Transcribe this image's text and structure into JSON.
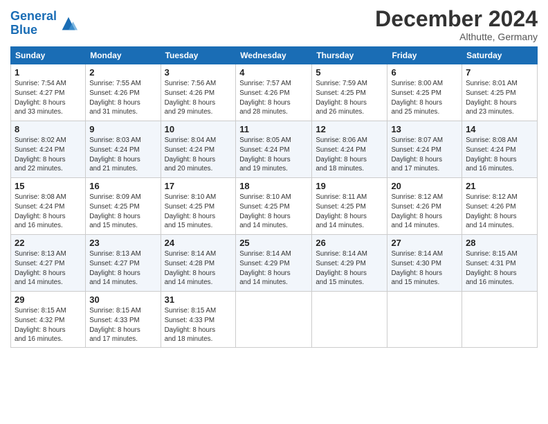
{
  "header": {
    "logo_line1": "General",
    "logo_line2": "Blue",
    "month": "December 2024",
    "location": "Althutte, Germany"
  },
  "weekdays": [
    "Sunday",
    "Monday",
    "Tuesday",
    "Wednesday",
    "Thursday",
    "Friday",
    "Saturday"
  ],
  "weeks": [
    [
      {
        "day": "1",
        "info": "Sunrise: 7:54 AM\nSunset: 4:27 PM\nDaylight: 8 hours\nand 33 minutes."
      },
      {
        "day": "2",
        "info": "Sunrise: 7:55 AM\nSunset: 4:26 PM\nDaylight: 8 hours\nand 31 minutes."
      },
      {
        "day": "3",
        "info": "Sunrise: 7:56 AM\nSunset: 4:26 PM\nDaylight: 8 hours\nand 29 minutes."
      },
      {
        "day": "4",
        "info": "Sunrise: 7:57 AM\nSunset: 4:26 PM\nDaylight: 8 hours\nand 28 minutes."
      },
      {
        "day": "5",
        "info": "Sunrise: 7:59 AM\nSunset: 4:25 PM\nDaylight: 8 hours\nand 26 minutes."
      },
      {
        "day": "6",
        "info": "Sunrise: 8:00 AM\nSunset: 4:25 PM\nDaylight: 8 hours\nand 25 minutes."
      },
      {
        "day": "7",
        "info": "Sunrise: 8:01 AM\nSunset: 4:25 PM\nDaylight: 8 hours\nand 23 minutes."
      }
    ],
    [
      {
        "day": "8",
        "info": "Sunrise: 8:02 AM\nSunset: 4:24 PM\nDaylight: 8 hours\nand 22 minutes."
      },
      {
        "day": "9",
        "info": "Sunrise: 8:03 AM\nSunset: 4:24 PM\nDaylight: 8 hours\nand 21 minutes."
      },
      {
        "day": "10",
        "info": "Sunrise: 8:04 AM\nSunset: 4:24 PM\nDaylight: 8 hours\nand 20 minutes."
      },
      {
        "day": "11",
        "info": "Sunrise: 8:05 AM\nSunset: 4:24 PM\nDaylight: 8 hours\nand 19 minutes."
      },
      {
        "day": "12",
        "info": "Sunrise: 8:06 AM\nSunset: 4:24 PM\nDaylight: 8 hours\nand 18 minutes."
      },
      {
        "day": "13",
        "info": "Sunrise: 8:07 AM\nSunset: 4:24 PM\nDaylight: 8 hours\nand 17 minutes."
      },
      {
        "day": "14",
        "info": "Sunrise: 8:08 AM\nSunset: 4:24 PM\nDaylight: 8 hours\nand 16 minutes."
      }
    ],
    [
      {
        "day": "15",
        "info": "Sunrise: 8:08 AM\nSunset: 4:24 PM\nDaylight: 8 hours\nand 16 minutes."
      },
      {
        "day": "16",
        "info": "Sunrise: 8:09 AM\nSunset: 4:25 PM\nDaylight: 8 hours\nand 15 minutes."
      },
      {
        "day": "17",
        "info": "Sunrise: 8:10 AM\nSunset: 4:25 PM\nDaylight: 8 hours\nand 15 minutes."
      },
      {
        "day": "18",
        "info": "Sunrise: 8:10 AM\nSunset: 4:25 PM\nDaylight: 8 hours\nand 14 minutes."
      },
      {
        "day": "19",
        "info": "Sunrise: 8:11 AM\nSunset: 4:25 PM\nDaylight: 8 hours\nand 14 minutes."
      },
      {
        "day": "20",
        "info": "Sunrise: 8:12 AM\nSunset: 4:26 PM\nDaylight: 8 hours\nand 14 minutes."
      },
      {
        "day": "21",
        "info": "Sunrise: 8:12 AM\nSunset: 4:26 PM\nDaylight: 8 hours\nand 14 minutes."
      }
    ],
    [
      {
        "day": "22",
        "info": "Sunrise: 8:13 AM\nSunset: 4:27 PM\nDaylight: 8 hours\nand 14 minutes."
      },
      {
        "day": "23",
        "info": "Sunrise: 8:13 AM\nSunset: 4:27 PM\nDaylight: 8 hours\nand 14 minutes."
      },
      {
        "day": "24",
        "info": "Sunrise: 8:14 AM\nSunset: 4:28 PM\nDaylight: 8 hours\nand 14 minutes."
      },
      {
        "day": "25",
        "info": "Sunrise: 8:14 AM\nSunset: 4:29 PM\nDaylight: 8 hours\nand 14 minutes."
      },
      {
        "day": "26",
        "info": "Sunrise: 8:14 AM\nSunset: 4:29 PM\nDaylight: 8 hours\nand 15 minutes."
      },
      {
        "day": "27",
        "info": "Sunrise: 8:14 AM\nSunset: 4:30 PM\nDaylight: 8 hours\nand 15 minutes."
      },
      {
        "day": "28",
        "info": "Sunrise: 8:15 AM\nSunset: 4:31 PM\nDaylight: 8 hours\nand 16 minutes."
      }
    ],
    [
      {
        "day": "29",
        "info": "Sunrise: 8:15 AM\nSunset: 4:32 PM\nDaylight: 8 hours\nand 16 minutes."
      },
      {
        "day": "30",
        "info": "Sunrise: 8:15 AM\nSunset: 4:33 PM\nDaylight: 8 hours\nand 17 minutes."
      },
      {
        "day": "31",
        "info": "Sunrise: 8:15 AM\nSunset: 4:33 PM\nDaylight: 8 hours\nand 18 minutes."
      },
      null,
      null,
      null,
      null
    ]
  ]
}
